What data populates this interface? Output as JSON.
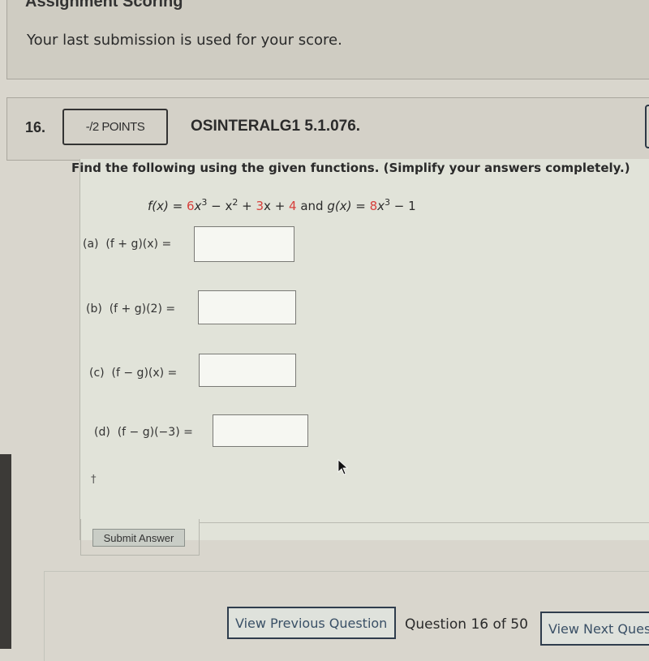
{
  "assignment_scoring": {
    "title": "Assignment Scoring",
    "description": "Your last submission is used for your score."
  },
  "question": {
    "number": "16.",
    "points": "-/2 POINTS",
    "code": "OSINTERALG1 5.1.076.",
    "instructions": "Find the following using the given functions. (Simplify your answers completely.)",
    "formula": {
      "f_label": "f(x) = ",
      "f_coef1": "6",
      "f_term1": "x",
      "f_exp1": "3",
      "f_minus": " − x",
      "f_exp2": "2",
      "f_plus1": " + ",
      "f_coef2": "3",
      "f_term3": "x + ",
      "f_const": "4",
      "and": " and ",
      "g_label": "g(x) = ",
      "g_coef1": "8",
      "g_term1": "x",
      "g_exp1": "3",
      "g_rest": " − 1"
    },
    "parts": [
      {
        "letter": "(a)",
        "expression": "(f + g)(x) =",
        "value": ""
      },
      {
        "letter": "(b)",
        "expression": "(f + g)(2) =",
        "value": ""
      },
      {
        "letter": "(c)",
        "expression": "(f − g)(x) =",
        "value": ""
      },
      {
        "letter": "(d)",
        "expression": "(f − g)(−3) =",
        "value": ""
      }
    ],
    "dagger": "†",
    "submit_label": "Submit Answer"
  },
  "navigation": {
    "previous_label": "View Previous Question",
    "counter": "Question 16 of 50",
    "next_label": "View Next Question"
  },
  "colors": {
    "highlight_red": "#d7403c",
    "nav_border": "#2f3d4d"
  }
}
